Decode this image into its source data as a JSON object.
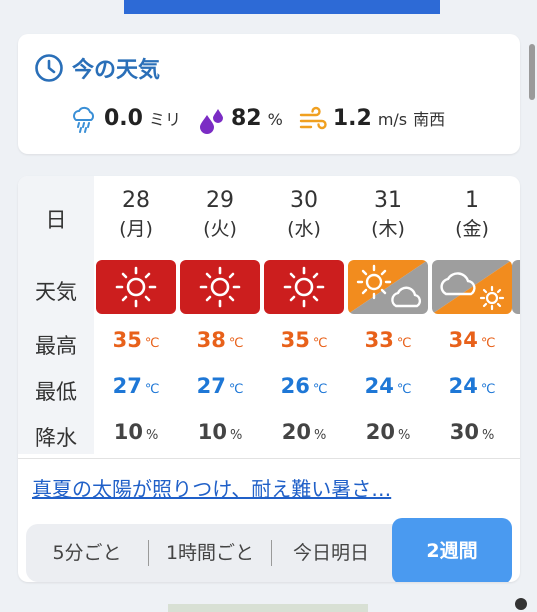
{
  "now": {
    "title": "今の天気",
    "precip_value": "0.0",
    "precip_unit": "ミリ",
    "humidity_value": "82",
    "humidity_unit": "%",
    "wind_value": "1.2",
    "wind_unit": "m/s",
    "wind_dir": "南西"
  },
  "labels": {
    "date": "日",
    "weather": "天気",
    "high": "最高",
    "low": "最低",
    "precip": "降水"
  },
  "temp_unit": "℃",
  "pct_unit": "%",
  "days": [
    {
      "date": "28",
      "dow": "(月)",
      "icon": "sunny-icon",
      "high": "35",
      "low": "27",
      "rain": "10"
    },
    {
      "date": "29",
      "dow": "(火)",
      "icon": "sunny-icon",
      "high": "38",
      "low": "27",
      "rain": "10"
    },
    {
      "date": "30",
      "dow": "(水)",
      "icon": "sunny-icon",
      "high": "35",
      "low": "26",
      "rain": "20"
    },
    {
      "date": "31",
      "dow": "(木)",
      "icon": "sunny-cloudy-icon",
      "high": "33",
      "low": "24",
      "rain": "20"
    },
    {
      "date": "1",
      "dow": "(金)",
      "icon": "cloudy-sunny-icon",
      "high": "34",
      "low": "24",
      "rain": "30"
    }
  ],
  "headline": "真夏の太陽が照りつけ、耐え難い暑さ…",
  "tabs": [
    "5分ごと",
    "1時間ごと",
    "今日明日",
    "2週間"
  ],
  "colors": {
    "accent": "#2a6fb8",
    "sunny_bg": "#cc1e1e",
    "partly_bg": "#f28c1e",
    "cloudy_bg": "#9e9e9e",
    "high": "#e8611a",
    "low": "#1e77d6",
    "active_tab": "#4a9af0"
  }
}
